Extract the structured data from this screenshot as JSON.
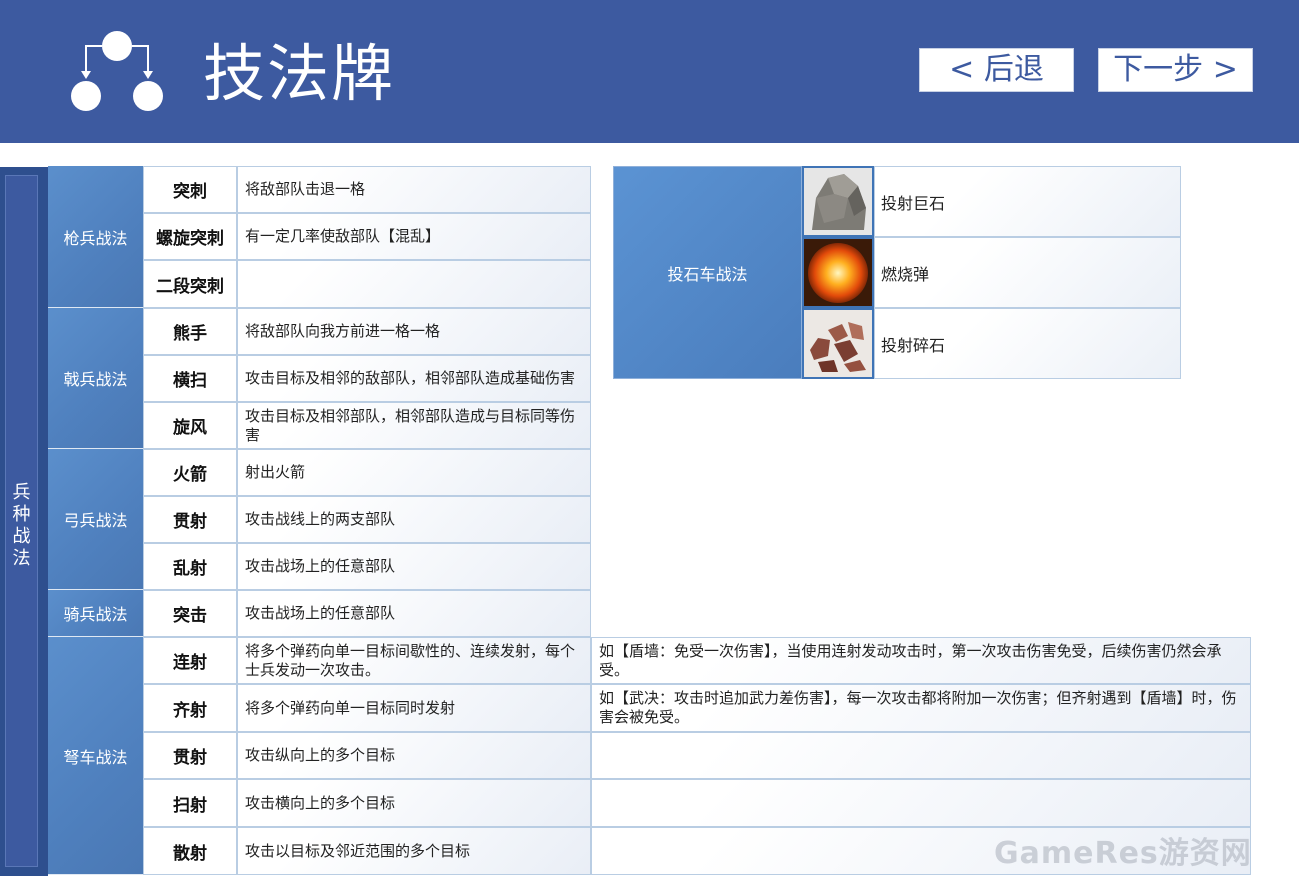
{
  "header": {
    "title": "技法牌",
    "back_label": "< 后退",
    "next_label": "下一步 >"
  },
  "side_label": "兵种战法",
  "groups": [
    {
      "label": "枪兵战法"
    },
    {
      "label": "戟兵战法"
    },
    {
      "label": "弓兵战法"
    },
    {
      "label": "骑兵战法"
    },
    {
      "label": "弩车战法"
    }
  ],
  "rows": [
    {
      "skill": "突刺",
      "desc": "将敌部队击退一格"
    },
    {
      "skill": "螺旋突刺",
      "desc": "有一定几率使敌部队【混乱】"
    },
    {
      "skill": "二段突刺",
      "desc": ""
    },
    {
      "skill": "熊手",
      "desc": "将敌部队向我方前进一格一格"
    },
    {
      "skill": "横扫",
      "desc": "攻击目标及相邻的敌部队，相邻部队造成基础伤害"
    },
    {
      "skill": "旋风",
      "desc": "攻击目标及相邻部队，相邻部队造成与目标同等伤害"
    },
    {
      "skill": "火箭",
      "desc": "射出火箭"
    },
    {
      "skill": "贯射",
      "desc": "攻击战线上的两支部队"
    },
    {
      "skill": "乱射",
      "desc": "攻击战场上的任意部队"
    },
    {
      "skill": "突击",
      "desc": "攻击战场上的任意部队"
    },
    {
      "skill": "连射",
      "desc": "将多个弹药向单一目标间歇性的、连续发射，每个士兵发动一次攻击。",
      "note": "如【盾墙：免受一次伤害】，当使用连射发动攻击时，第一次攻击伤害免受，后续伤害仍然会承受。"
    },
    {
      "skill": "齐射",
      "desc": "将多个弹药向单一目标同时发射",
      "note": "如【武决：攻击时追加武力差伤害】，每一次攻击都将附加一次伤害；但齐射遇到【盾墙】时，伤害会被免受。"
    },
    {
      "skill": "贯射",
      "desc": "攻击纵向上的多个目标",
      "note": ""
    },
    {
      "skill": "扫射",
      "desc": "攻击横向上的多个目标",
      "note": ""
    },
    {
      "skill": "散射",
      "desc": "攻击以目标及邻近范围的多个目标",
      "note": ""
    }
  ],
  "catapult": {
    "group_label": "投石车战法",
    "items": [
      {
        "label": "投射巨石",
        "image": "boulder-image"
      },
      {
        "label": "燃烧弹",
        "image": "fireball-image"
      },
      {
        "label": "投射碎石",
        "image": "rubble-image"
      }
    ]
  },
  "watermark": "GameRes游资网",
  "colors": {
    "header_bg": "#3d5aa0",
    "group_bg": "#4f80be",
    "border": "#b9cde3"
  }
}
